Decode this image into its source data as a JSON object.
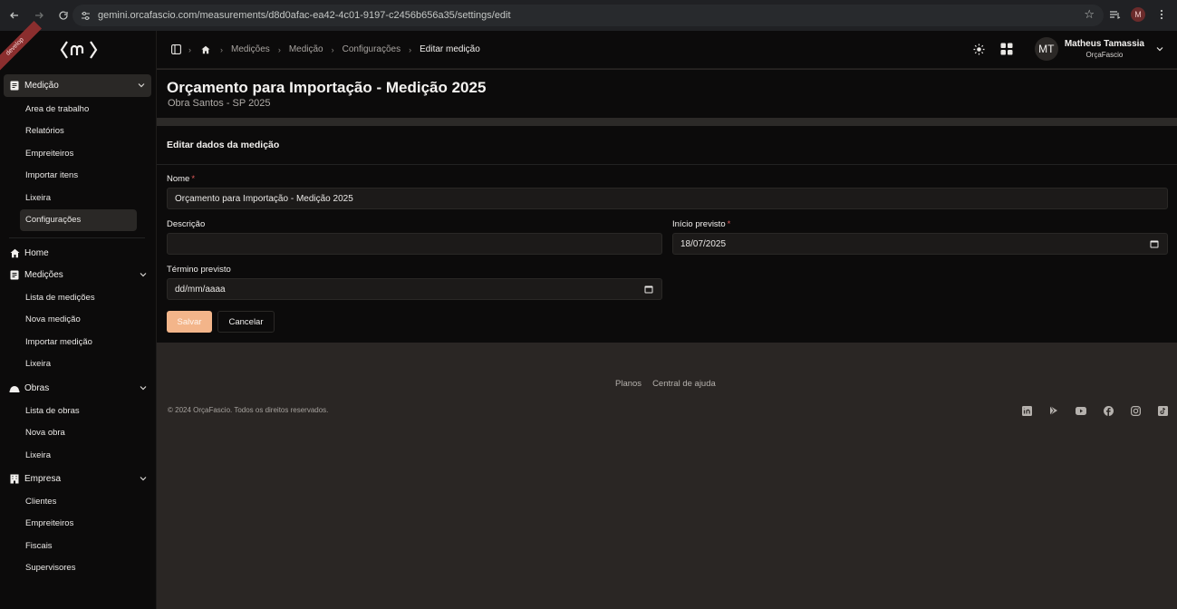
{
  "browser": {
    "url": "gemini.orcafascio.com/measurements/d8d0afac-ea42-4c01-9197-c2456b656a35/settings/edit",
    "profile_initial": "M"
  },
  "sidebar": {
    "ribbon": "develop",
    "active_group": {
      "label": "Medição",
      "items": [
        {
          "label": "Area de trabalho"
        },
        {
          "label": "Relatórios"
        },
        {
          "label": "Empreiteiros"
        },
        {
          "label": "Importar itens"
        },
        {
          "label": "Lixeira"
        },
        {
          "label": "Configurações",
          "selected": true
        }
      ]
    },
    "home": {
      "label": "Home"
    },
    "medicoes": {
      "label": "Medições",
      "items": [
        {
          "label": "Lista de medições"
        },
        {
          "label": "Nova medição"
        },
        {
          "label": "Importar medição"
        },
        {
          "label": "Lixeira"
        }
      ]
    },
    "obras": {
      "label": "Obras",
      "items": [
        {
          "label": "Lista de obras"
        },
        {
          "label": "Nova obra"
        },
        {
          "label": "Lixeira"
        }
      ]
    },
    "empresa": {
      "label": "Empresa",
      "items": [
        {
          "label": "Clientes"
        },
        {
          "label": "Empreiteiros"
        },
        {
          "label": "Fiscais"
        },
        {
          "label": "Supervisores"
        }
      ]
    }
  },
  "breadcrumb": [
    "Medições",
    "Medição",
    "Configurações",
    "Editar medição"
  ],
  "user": {
    "initials": "MT",
    "name": "Matheus Tamassia",
    "org": "OrçaFascio"
  },
  "header": {
    "title": "Orçamento para Importação - Medição 2025",
    "subtitle": "Obra Santos - SP 2025"
  },
  "form": {
    "title": "Editar dados da medição",
    "nome_label": "Nome",
    "nome_value": "Orçamento para Importação - Medição 2025",
    "descricao_label": "Descrição",
    "descricao_value": "",
    "inicio_label": "Início previsto",
    "inicio_value": "18/07/2025",
    "termino_label": "Término previsto",
    "termino_value": "dd/mm/aaaa",
    "save_label": "Salvar",
    "cancel_label": "Cancelar"
  },
  "footer": {
    "links": [
      "Planos",
      "Central de ajuda"
    ],
    "copyright": "© 2024 OrçaFascio. Todos os direitos reservados.",
    "socials": [
      "linkedin-icon",
      "play-icon",
      "youtube-icon",
      "facebook-icon",
      "instagram-icon",
      "tiktok-icon"
    ]
  },
  "colors": {
    "accent": "#f3b58a",
    "required": "#e05a5a",
    "sidebar_bg": "#0c0b0b",
    "page_bg": "#2a2624"
  }
}
